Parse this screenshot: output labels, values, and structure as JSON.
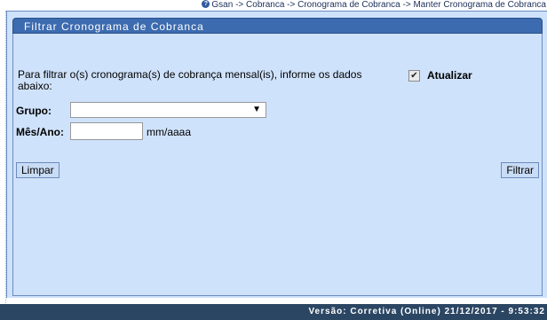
{
  "breadcrumb": {
    "text": "Gsan -> Cobranca -> Cronograma de Cobranca -> Manter Cronograma de Cobranca",
    "icon": "help-icon"
  },
  "panel": {
    "title": "Filtrar Cronograma de Cobranca"
  },
  "form": {
    "intro": "Para filtrar o(s) cronograma(s) de cobrança mensal(is), informe os dados abaixo:",
    "update_label": "Atualizar",
    "update_checked": true,
    "grupo_label": "Grupo:",
    "grupo_value": "",
    "mes_ano_label": "Mês/Ano:",
    "mes_ano_value": "",
    "mes_ano_hint": "mm/aaaa"
  },
  "buttons": {
    "clear": "Limpar",
    "filter": "Filtrar"
  },
  "footer": {
    "version": "Versão: Corretiva (Online) 21/12/2017 - 9:53:32"
  },
  "colors": {
    "panel_bg": "#cfe2fb",
    "title_bar": "#3c6bb0",
    "footer_bg": "#2b4663"
  }
}
